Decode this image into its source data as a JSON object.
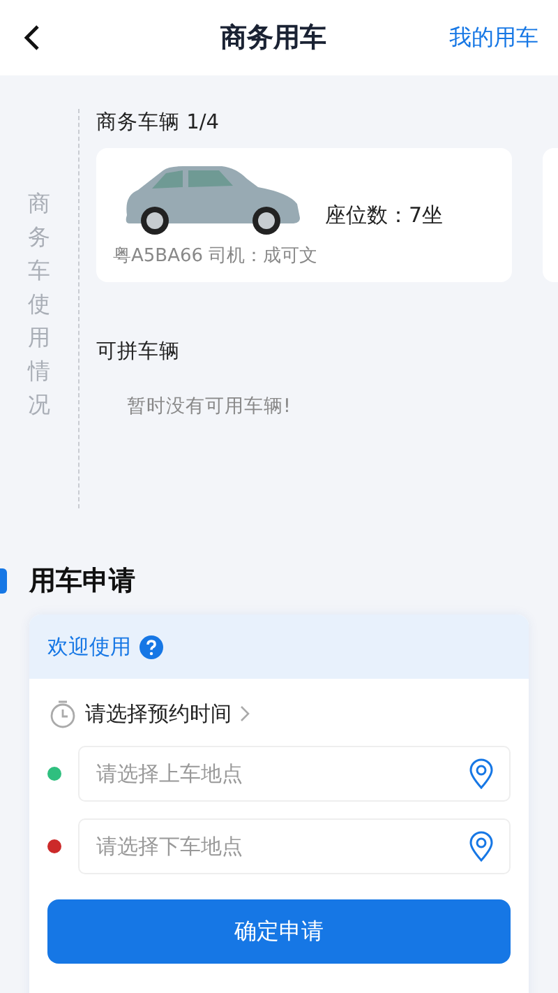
{
  "header": {
    "title": "商务用车",
    "action": "我的用车"
  },
  "side_label": "商务车使用情况",
  "vehicles": {
    "title": "商务车辆 1/4",
    "cards": [
      {
        "seats": "座位数：7坐",
        "info": "粤A5BA66 司机：成可文"
      }
    ]
  },
  "carpool": {
    "title": "可拼车辆",
    "empty": "暂时没有可用车辆!"
  },
  "application": {
    "title": "用车申请",
    "welcome": "欢迎使用",
    "time": "请选择预约时间",
    "locations": [
      {
        "placeholder": "请选择上车地点",
        "color": "#2fbf7f"
      },
      {
        "placeholder": "请选择下车地点",
        "color": "#cc2a2a"
      }
    ],
    "submit": "确定申请"
  }
}
